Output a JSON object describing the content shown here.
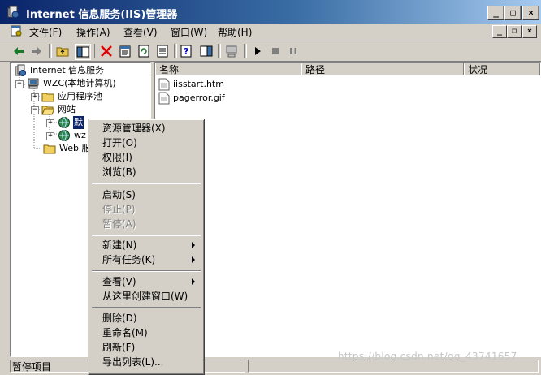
{
  "window": {
    "title": "Internet 信息服务(IIS)管理器",
    "buttons": {
      "minimize": "_",
      "maximize": "□",
      "close": "×"
    }
  },
  "menubar": {
    "items": [
      "文件(F)",
      "操作(A)",
      "查看(V)",
      "窗口(W)",
      "帮助(H)"
    ],
    "mdi_buttons": {
      "minimize": "_",
      "restore": "❐",
      "close": "×"
    }
  },
  "tree": {
    "root": "Internet 信息服务",
    "computer": "WZC(本地计算机)",
    "app_pools": "应用程序池",
    "websites": "网站",
    "site1": "默",
    "site2": "wz",
    "web_ext": "Web 服"
  },
  "list": {
    "columns": [
      "名称",
      "路径",
      "状况"
    ],
    "files": [
      "iisstart.htm",
      "pagerror.gif"
    ]
  },
  "context_menu": {
    "group1": [
      {
        "label": "资源管理器(X)",
        "enabled": true
      },
      {
        "label": "打开(O)",
        "enabled": true
      },
      {
        "label": "权限(I)",
        "enabled": true
      },
      {
        "label": "浏览(B)",
        "enabled": true
      }
    ],
    "group2": [
      {
        "label": "启动(S)",
        "enabled": true
      },
      {
        "label": "停止(P)",
        "enabled": false
      },
      {
        "label": "暂停(A)",
        "enabled": false
      }
    ],
    "group3": [
      {
        "label": "新建(N)",
        "enabled": true,
        "submenu": true
      },
      {
        "label": "所有任务(K)",
        "enabled": true,
        "submenu": true
      }
    ],
    "group4": [
      {
        "label": "查看(V)",
        "enabled": true,
        "submenu": true
      },
      {
        "label": "从这里创建窗口(W)",
        "enabled": true
      }
    ],
    "group5": [
      {
        "label": "删除(D)",
        "enabled": true
      },
      {
        "label": "重命名(M)",
        "enabled": true
      },
      {
        "label": "刷新(F)",
        "enabled": true
      },
      {
        "label": "导出列表(L)...",
        "enabled": true
      }
    ]
  },
  "status": {
    "text": "暂停项目"
  },
  "watermark": "https://blog.csdn.net/qq_43741657",
  "colors": {
    "title_start": "#0a246a",
    "title_end": "#a6caf0",
    "face": "#d4d0c8",
    "selection": "#0a246a"
  }
}
